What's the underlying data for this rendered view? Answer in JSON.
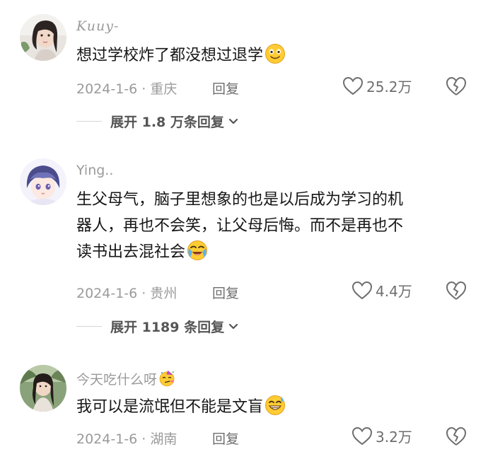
{
  "comments": [
    {
      "username": "Kuuy-",
      "text": "想过学校炸了都没想过退学",
      "emoji": "smiling-face",
      "date_location": "2024-1-6 · 重庆",
      "reply_label": "回复",
      "likes": "25.2万",
      "expand_label": "展开 1.8 万条回复"
    },
    {
      "username": "Ying..",
      "text": "生父母气，脑子里想象的也是以后成为学习的机\n器人，再也不会笑，让父母后悔。而不是再也不\n读书出去混社会",
      "emoji": "loudly-crying-face",
      "date_location": "2024-1-6 · 贵州",
      "reply_label": "回复",
      "likes": "4.4万",
      "expand_label": "展开 1189 条回复"
    },
    {
      "username": "今天吃什么呀",
      "username_emoji": "partying-face",
      "text": "我可以是流氓但不能是文盲",
      "emoji": "grinning-sweat-face",
      "date_location": "2024-1-6 · 湖南",
      "reply_label": "回复",
      "likes": "3.2万"
    }
  ],
  "colors": {
    "meta_gray": "#9a9a9a",
    "text_dark": "#161616",
    "emoji_yellow": "#ffcc33"
  }
}
